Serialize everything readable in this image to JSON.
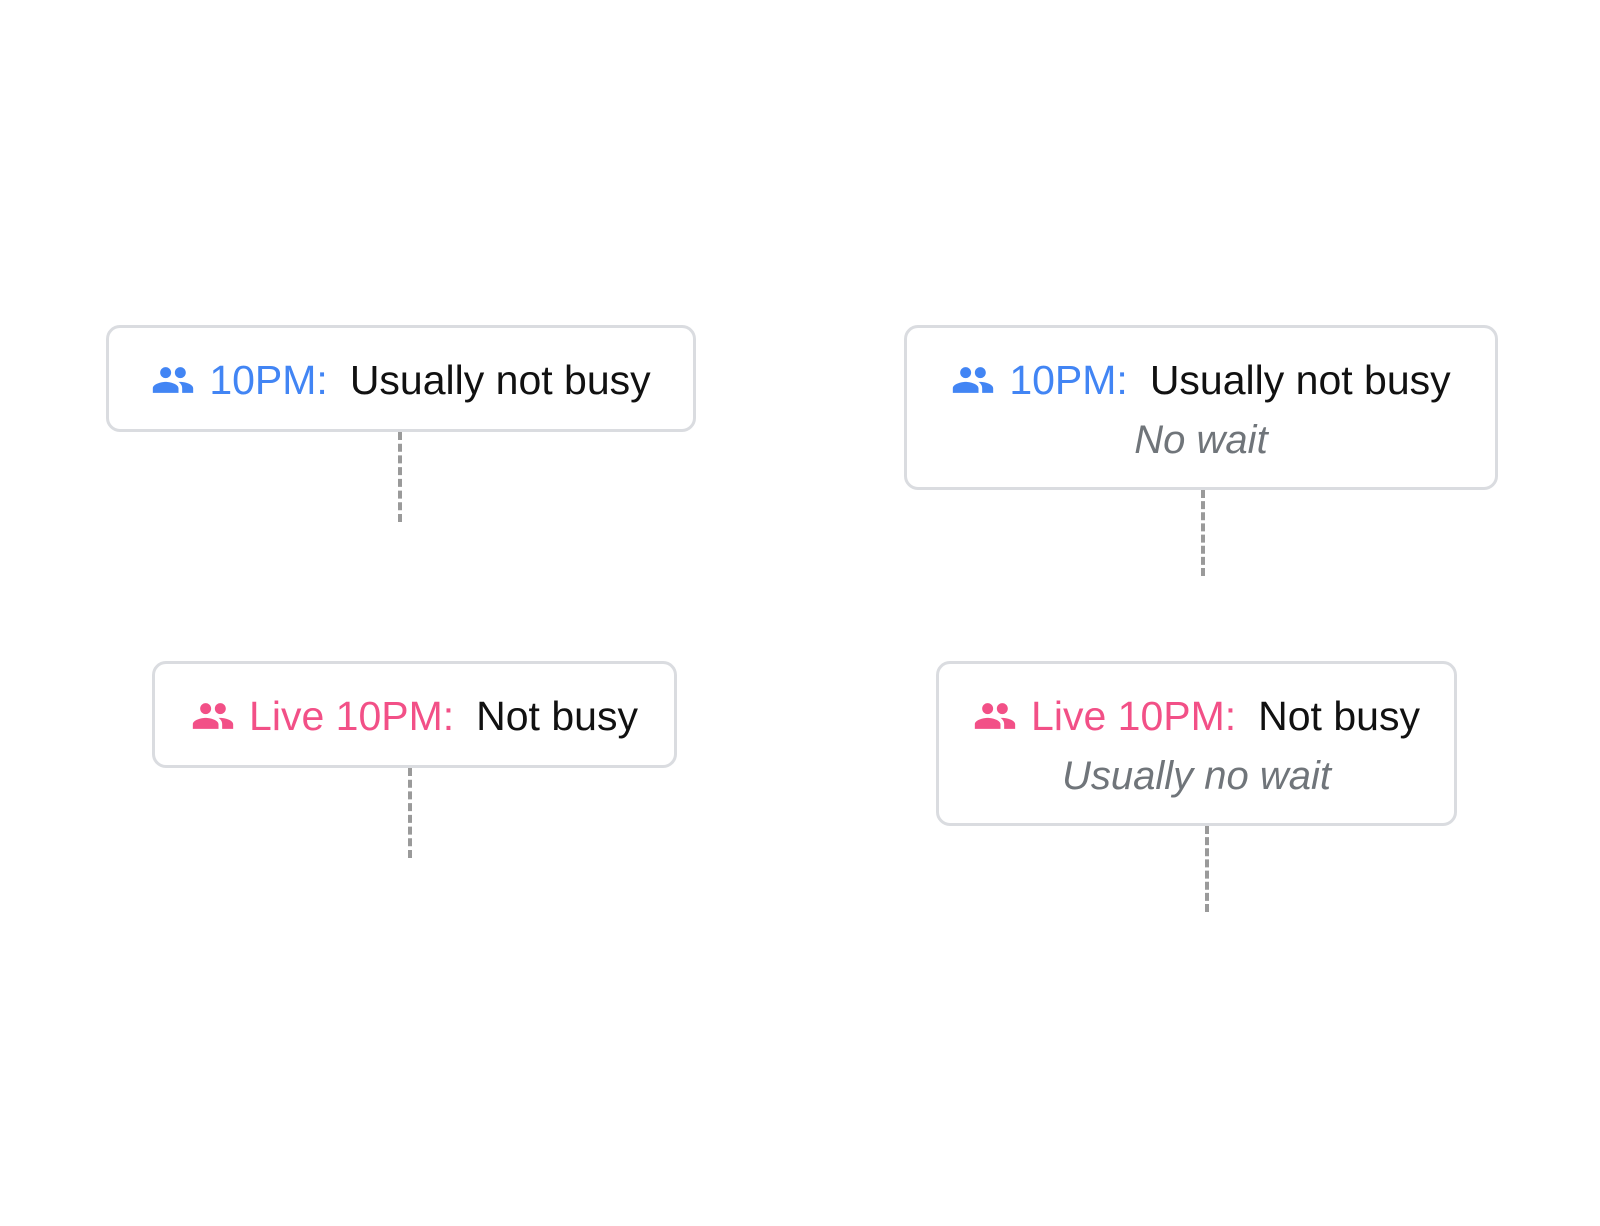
{
  "colors": {
    "typical": "#4285f4",
    "live": "#f25087",
    "status_text": "#111111",
    "subtext": "#70757a",
    "border": "#dadce0",
    "dash": "#9a9a9a"
  },
  "tooltips": [
    {
      "icon": "people-icon",
      "time_label": "10PM:",
      "status": "Usually not busy",
      "subtext": ""
    },
    {
      "icon": "people-icon",
      "time_label": "10PM:",
      "status": "Usually not busy",
      "subtext": "No wait"
    },
    {
      "icon": "people-icon",
      "time_label": "Live 10PM:",
      "status": "Not busy",
      "subtext": ""
    },
    {
      "icon": "people-icon",
      "time_label": "Live 10PM:",
      "status": "Not busy",
      "subtext": "Usually no wait"
    }
  ]
}
